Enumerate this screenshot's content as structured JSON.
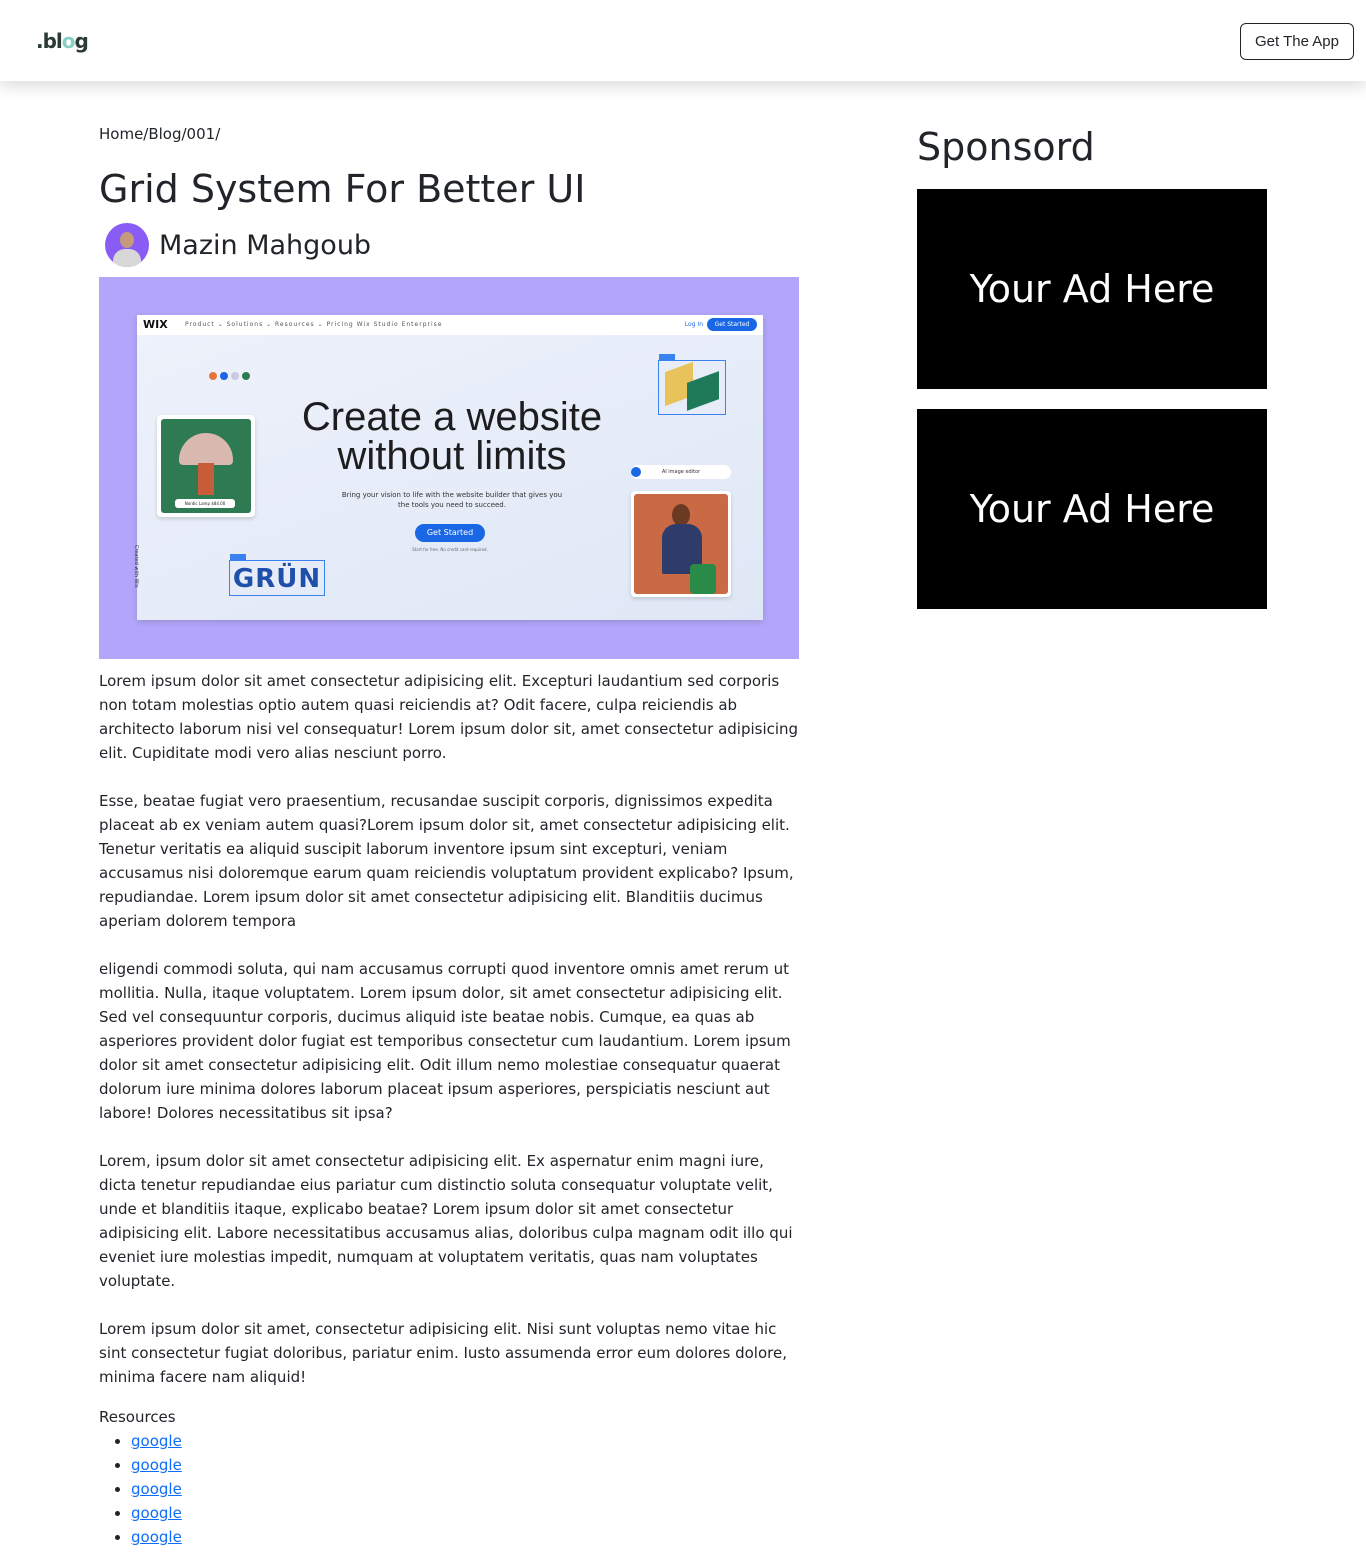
{
  "navbar": {
    "logo_prefix": ".bl",
    "logo_o": "o",
    "logo_suffix": "g",
    "get_app_label": "Get The App"
  },
  "breadcrumb": {
    "text": "Home/Blog/001/"
  },
  "article": {
    "title": "Grid System For Better UI",
    "author": "Mazin Mahgoub",
    "hero": {
      "brand": "WIX",
      "nav_links": "Product ⌄  Solutions ⌄  Resources ⌄  Pricing   Wix Studio   Enterprise",
      "login": "Log In",
      "nav_cta": "Get Started",
      "headline_line1": "Create a website",
      "headline_line2": "without limits",
      "subline": "Bring your vision to life with the website builder that gives you the tools you need to succeed.",
      "cta": "Get Started",
      "free_note": "Start for free. No credit card required.",
      "lamp_tag": "Nordic Lamp $84.00",
      "ai_pill": "AI image editor",
      "grun": "GRÜN",
      "side_text": "Created with Wix",
      "dot_colors": [
        "#e8743b",
        "#1a67e5",
        "#c9c9e8",
        "#2e7a52"
      ]
    },
    "paragraphs": [
      "Lorem ipsum dolor sit amet consectetur adipisicing elit. Excepturi laudantium sed corporis non totam molestias optio autem quasi reiciendis at? Odit facere, culpa reiciendis ab architecto laborum nisi vel consequatur! Lorem ipsum dolor sit, amet consectetur adipisicing elit. Cupiditate modi vero alias nesciunt porro.",
      "Esse, beatae fugiat vero praesentium, recusandae suscipit corporis, dignissimos expedita placeat ab ex veniam autem quasi?Lorem ipsum dolor sit, amet consectetur adipisicing elit. Tenetur veritatis ea aliquid suscipit laborum inventore ipsum sint excepturi, veniam accusamus nisi doloremque earum quam reiciendis voluptatum provident explicabo? Ipsum, repudiandae. Lorem ipsum dolor sit amet consectetur adipisicing elit. Blanditiis ducimus aperiam dolorem tempora",
      "eligendi commodi soluta, qui nam accusamus corrupti quod inventore omnis amet rerum ut mollitia. Nulla, itaque voluptatem. Lorem ipsum dolor, sit amet consectetur adipisicing elit. Sed vel consequuntur corporis, ducimus aliquid iste beatae nobis. Cumque, ea quas ab asperiores provident dolor fugiat est temporibus consectetur cum laudantium. Lorem ipsum dolor sit amet consectetur adipisicing elit. Odit illum nemo molestiae consequatur quaerat dolorum iure minima dolores laborum placeat ipsum asperiores, perspiciatis nesciunt aut labore! Dolores necessitatibus sit ipsa?",
      "Lorem, ipsum dolor sit amet consectetur adipisicing elit. Ex aspernatur enim magni iure, dicta tenetur repudiandae eius pariatur cum distinctio soluta consequatur voluptate velit, unde et blanditiis itaque, explicabo beatae? Lorem ipsum dolor sit amet consectetur adipisicing elit. Labore necessitatibus accusamus alias, doloribus culpa magnam odit illo qui eveniet iure molestias impedit, numquam at voluptatem veritatis, quas nam voluptates voluptate.",
      "Lorem ipsum dolor sit amet, consectetur adipisicing elit. Nisi sunt voluptas nemo vitae hic sint consectetur fugiat doloribus, pariatur enim. Iusto assumenda error eum dolores dolore, minima facere nam aliquid!"
    ],
    "resources_label": "Resources",
    "resources": [
      "google",
      "google",
      "google",
      "google",
      "google"
    ]
  },
  "sidebar": {
    "title": "Sponsord",
    "ads": [
      "Your Ad Here",
      "Your Ad Here"
    ]
  },
  "colors": {
    "link": "#0d6efd",
    "hero_bg": "#b3a6fa",
    "ad_bg": "#000000",
    "avatar_bg": "#8a5cf6"
  }
}
